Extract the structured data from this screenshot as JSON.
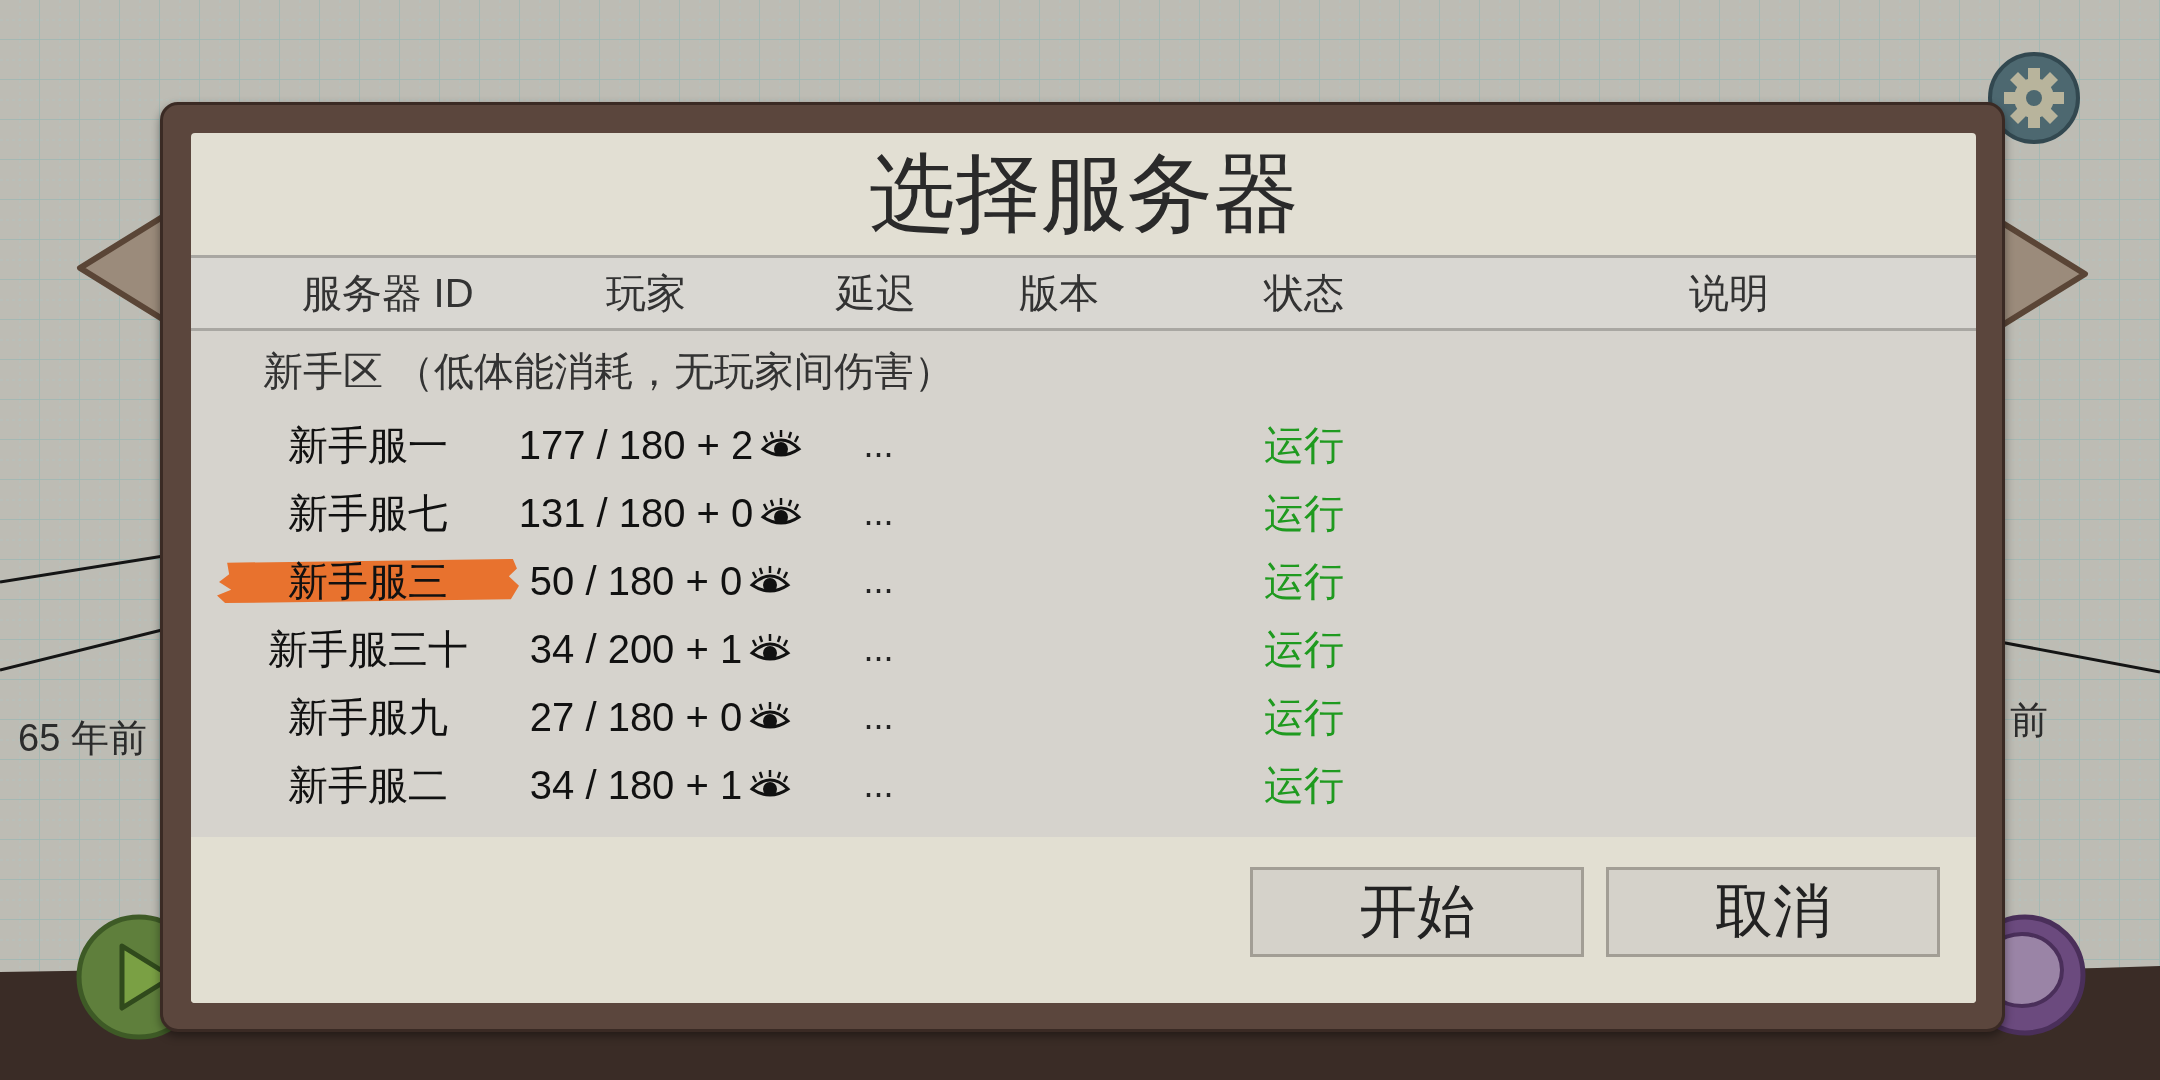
{
  "title": "选择服务器",
  "columns": [
    "服务器 ID",
    "玩家",
    "延迟",
    "版本",
    "状态",
    "说明"
  ],
  "section": {
    "label": "新手区 （低体能消耗，无玩家间伤害）",
    "servers": [
      {
        "name": "新手服一",
        "players": "177 / 180 + 2",
        "latency": "...",
        "status": "运行",
        "selected": false
      },
      {
        "name": "新手服七",
        "players": "131 / 180 + 0",
        "latency": "...",
        "status": "运行",
        "selected": false
      },
      {
        "name": "新手服三",
        "players": "50 / 180 + 0",
        "latency": "...",
        "status": "运行",
        "selected": true
      },
      {
        "name": "新手服三十",
        "players": "34 / 200 + 1",
        "latency": "...",
        "status": "运行",
        "selected": false
      },
      {
        "name": "新手服九",
        "players": "27 / 180 + 0",
        "latency": "...",
        "status": "运行",
        "selected": false
      },
      {
        "name": "新手服二",
        "players": "34 / 180 + 1",
        "latency": "...",
        "status": "运行",
        "selected": false
      }
    ]
  },
  "buttons": [
    "开始",
    "取消"
  ],
  "background_labels": [
    "65 年前",
    "前"
  ]
}
